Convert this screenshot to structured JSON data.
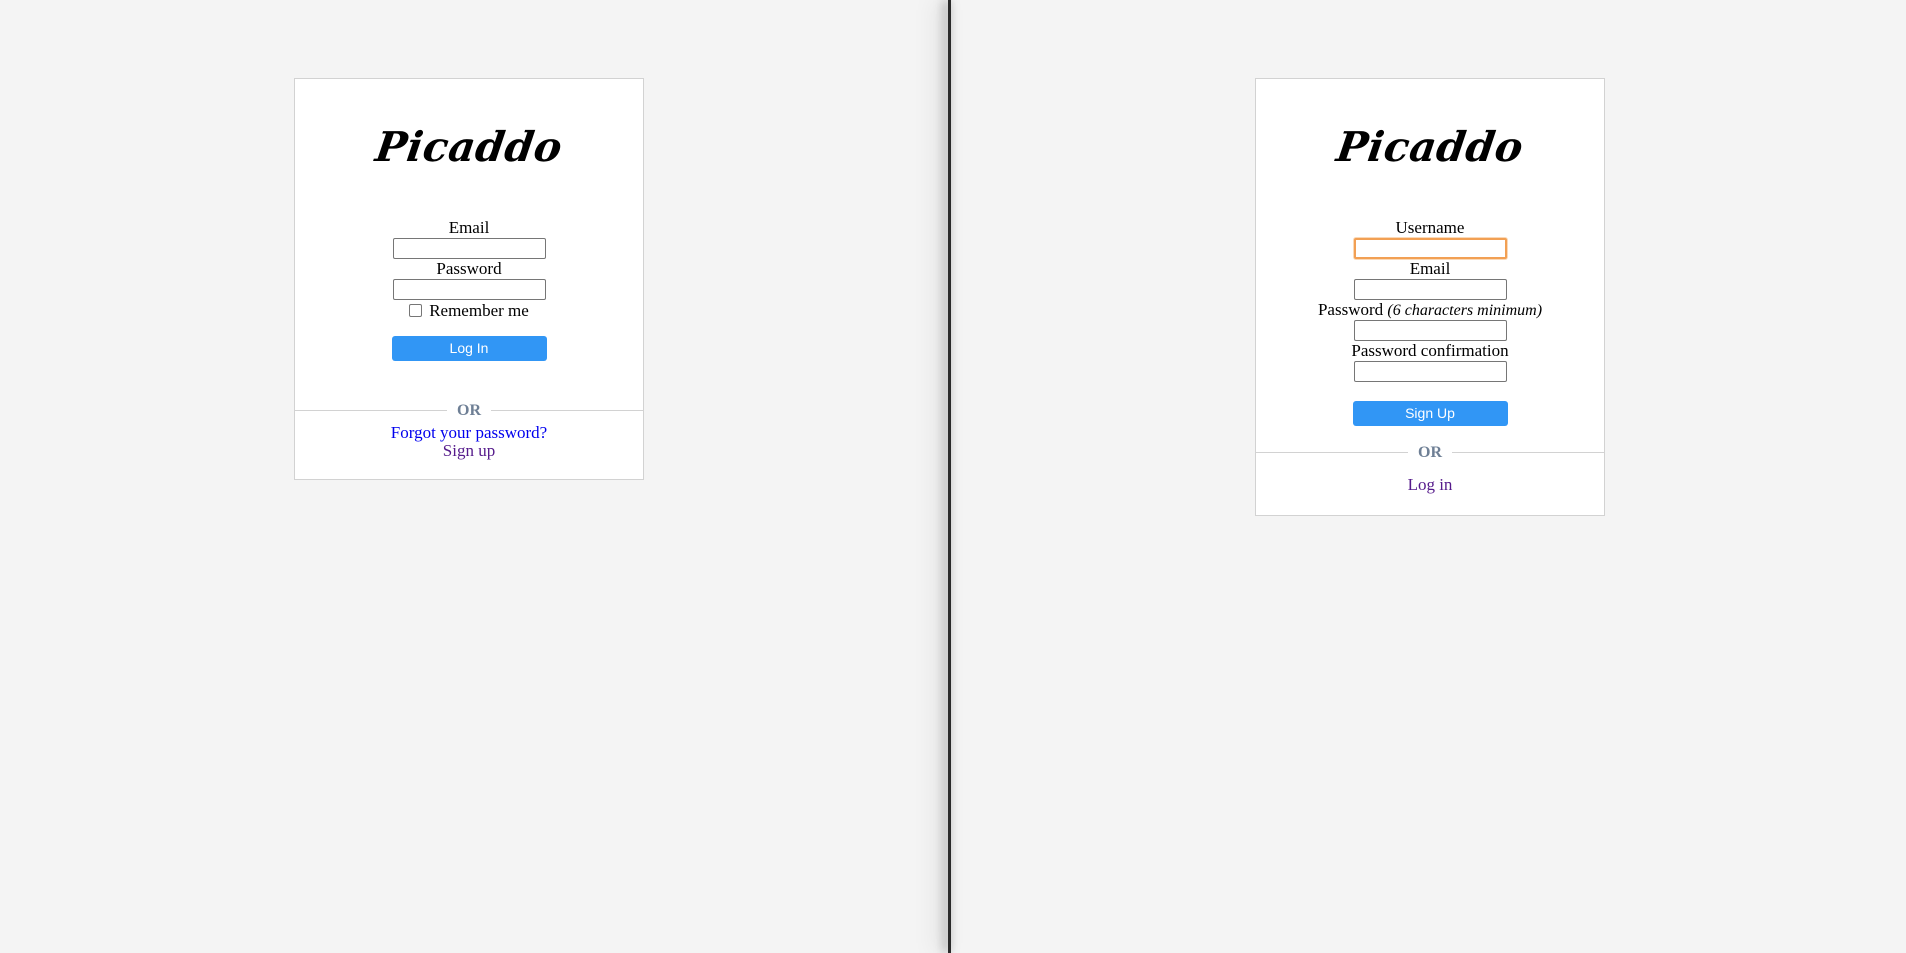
{
  "login": {
    "logo": "Picaddo",
    "email_label": "Email",
    "email_value": "",
    "password_label": "Password",
    "password_value": "",
    "remember_label": "Remember me",
    "remember_checked": false,
    "submit_label": "Log In",
    "or_label": "OR",
    "forgot_link": "Forgot your password?",
    "signup_link": "Sign up"
  },
  "signup": {
    "logo": "Picaddo",
    "username_label": "Username",
    "username_value": "",
    "email_label": "Email",
    "email_value": "",
    "password_label": "Password",
    "password_hint": "(6 characters minimum)",
    "password_value": "",
    "confirmation_label": "Password confirmation",
    "confirmation_value": "",
    "submit_label": "Sign Up",
    "or_label": "OR",
    "login_link": "Log in"
  },
  "colors": {
    "page_background": "#f4f4f4",
    "card_background": "#ffffff",
    "primary_button": "#3196f5",
    "or_text": "#6e7f95",
    "focus_outline": "#f2a054",
    "link_unvisited": "#0000ee",
    "link_visited": "#551a8b"
  }
}
